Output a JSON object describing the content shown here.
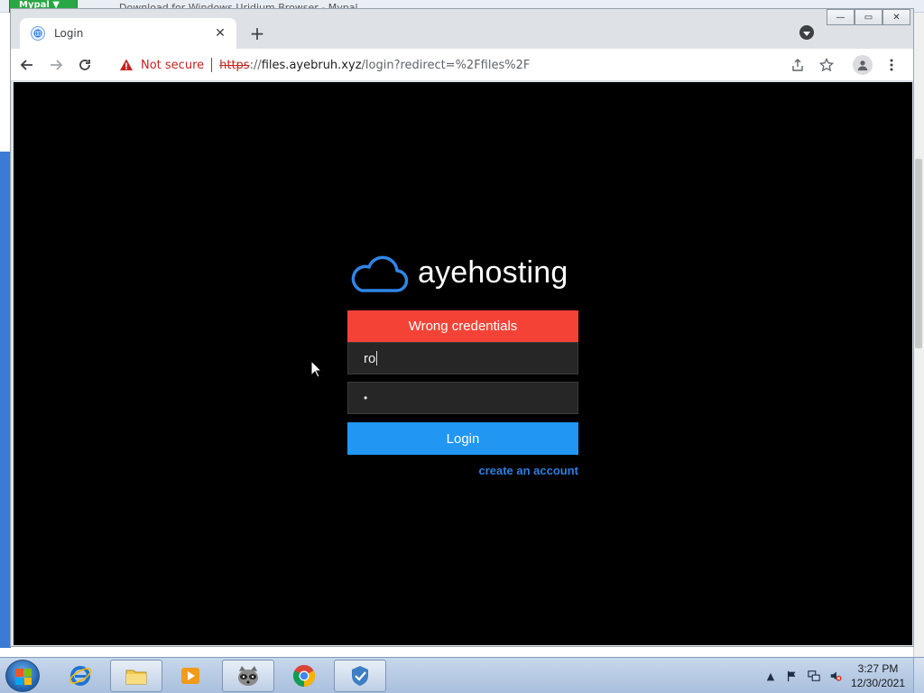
{
  "background": {
    "mypal_tab": "Mypal ▼",
    "window_title": "Download for Windows Uridium Browser - Mypal"
  },
  "browser": {
    "tab": {
      "title": "Login",
      "close_glyph": "✕"
    },
    "new_tab_glyph": "+",
    "window_controls": {
      "minimize": "—",
      "maximize": "▭",
      "close": "✕"
    },
    "omnibox": {
      "security_text": "Not secure",
      "url_scheme": "https",
      "url_sep": "://",
      "url_host": "files.ayebruh.xyz",
      "url_path": "/login?redirect=%2Ffiles%2F"
    },
    "icons": [
      "back-icon",
      "forward-icon",
      "reload-icon",
      "warning-icon",
      "share-icon",
      "star-icon",
      "profile-icon",
      "menu-icon"
    ]
  },
  "page": {
    "brand": "ayehosting",
    "error_message": "Wrong credentials",
    "username_value": "ro",
    "password_value": "•",
    "login_button": "Login",
    "create_account_link": "create an account",
    "colors": {
      "error": "#f44336",
      "primary": "#2196f3",
      "link": "#2f7fe0",
      "logo_cloud": "#2f86e6",
      "background": "#000000"
    }
  },
  "taskbar": {
    "apps": [
      "internet-explorer",
      "file-explorer",
      "media-player",
      "raccoon-app",
      "chrome",
      "security-app"
    ],
    "clock_time": "3:27 PM",
    "clock_date": "12/30/2021"
  }
}
